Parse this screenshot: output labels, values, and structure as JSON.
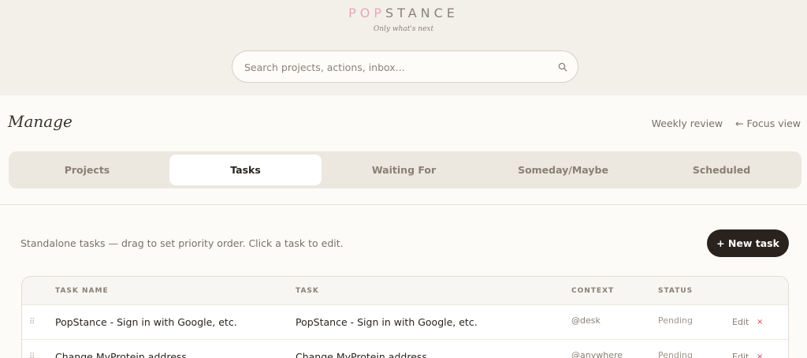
{
  "brand": {
    "logo_pop": "POP",
    "logo_stance": "STANCE",
    "tagline": "Only what's next"
  },
  "search": {
    "placeholder": "Search projects, actions, inbox...",
    "value": "",
    "icon": "search-icon"
  },
  "manage": {
    "title": "Manage",
    "links": {
      "weekly_review": "Weekly review",
      "focus_view": "← Focus view"
    },
    "tabs": [
      {
        "label": "Projects",
        "active": false
      },
      {
        "label": "Tasks",
        "active": true
      },
      {
        "label": "Waiting For",
        "active": false
      },
      {
        "label": "Someday/Maybe",
        "active": false
      },
      {
        "label": "Scheduled",
        "active": false
      }
    ],
    "hint": "Standalone tasks — drag to set priority order. Click a task to edit.",
    "new_task_label": "+ New task"
  },
  "table": {
    "headers": {
      "task_name": "TASK NAME",
      "task": "TASK",
      "context": "CONTEXT",
      "status": "STATUS"
    },
    "rows": [
      {
        "task_name": "PopStance - Sign in with Google, etc.",
        "task": "PopStance - Sign in with Google, etc.",
        "context": "@desk",
        "status": "Pending",
        "edit": "Edit",
        "delete": "×"
      },
      {
        "task_name": "Change MyProtein address",
        "task": "Change MyProtein address",
        "context": "@anywhere",
        "status": "Pending",
        "edit": "Edit",
        "delete": "×"
      }
    ]
  },
  "colors": {
    "accent_pink": "#e6a8b6",
    "button_dark": "#2a221c",
    "delete_red": "#d4485a",
    "background": "#f3f0ea"
  }
}
